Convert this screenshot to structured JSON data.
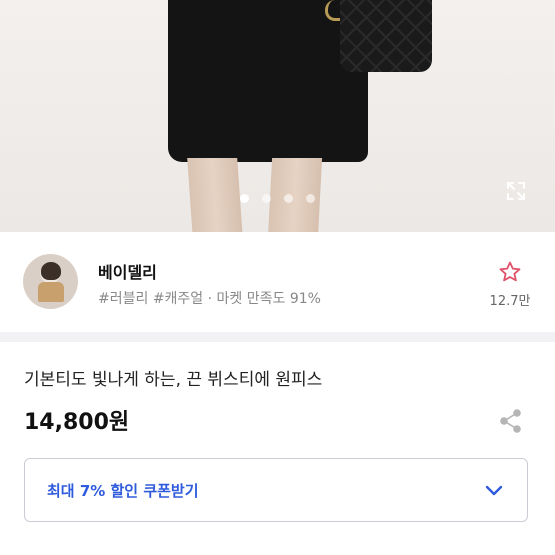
{
  "carousel": {
    "total": 4,
    "active_index": 0
  },
  "shop": {
    "name": "베이델리",
    "tags": "#러블리 #캐주얼 · 마켓 만족도 91%",
    "favorite_count": "12.7만"
  },
  "product": {
    "title": "기본티도 빛나게 하는, 끈 뷔스티에 원피스",
    "price": "14,800원"
  },
  "coupon": {
    "label": "최대 7% 할인 쿠폰받기"
  },
  "colors": {
    "accent": "#2f5bdc",
    "favorite": "#e0526a"
  }
}
